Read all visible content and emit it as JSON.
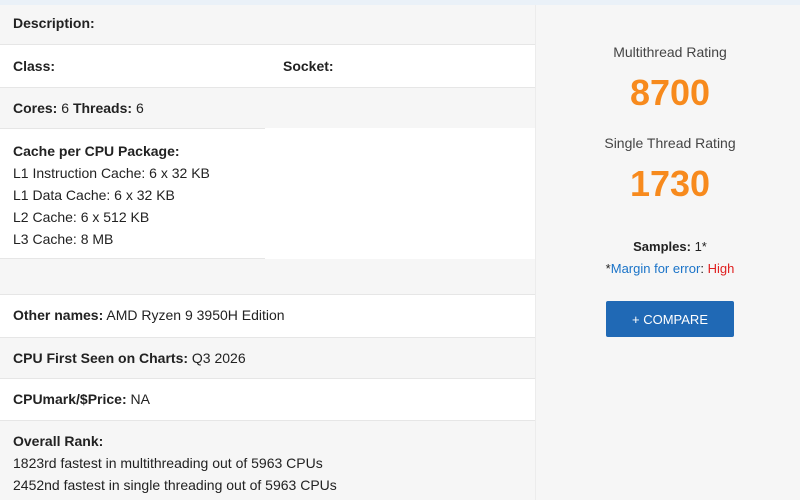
{
  "spec": {
    "description_label": "Description:",
    "class_label": "Class:",
    "socket_label": "Socket:",
    "cores_label": "Cores:",
    "cores_value": "6",
    "threads_label": "Threads:",
    "threads_value": "6",
    "cache_title": "Cache per CPU Package:",
    "cache_lines": [
      "L1 Instruction Cache: 6 x 32 KB",
      "L1 Data Cache: 6 x 32 KB",
      "L2 Cache: 6 x 512 KB",
      "L3 Cache: 8 MB"
    ],
    "other_names_label": "Other names:",
    "other_names_value": "AMD Ryzen 9 3950H Edition",
    "first_seen_label": "CPU First Seen on Charts:",
    "first_seen_value": "Q3 2026",
    "cpumark_price_label": "CPUmark/$Price:",
    "cpumark_price_value": "NA",
    "overall_rank_label": "Overall Rank:",
    "rank_lines": [
      "1823rd fastest in multithreading out of 5963 CPUs",
      "2452nd fastest in single threading out of 5963 CPUs"
    ]
  },
  "ratings": {
    "multithread_label": "Multithread Rating",
    "multithread_value": "8700",
    "single_label": "Single Thread Rating",
    "single_value": "1730",
    "samples_label": "Samples:",
    "samples_value": "1*",
    "asterisk": "*",
    "margin_label": "Margin for error",
    "colon": ":",
    "margin_value": "High",
    "compare_button": "+ COMPARE"
  },
  "colors": {
    "rating_orange": "#f78a1d",
    "button_blue": "#2069b5",
    "link_blue": "#1a73c8",
    "high_red": "#e02020"
  }
}
